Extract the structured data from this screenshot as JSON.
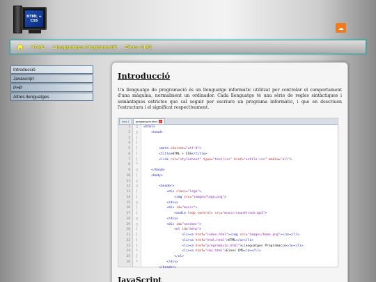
{
  "logo": {
    "text": "HTML + CSS"
  },
  "music_icon": "soundcloud-icon",
  "navbar": {
    "home_icon": "home-icon",
    "items": [
      "HTML",
      "Llenguatges Programació",
      "Eines CMS"
    ]
  },
  "sidebar": {
    "items": [
      "Introducció",
      "Javascript",
      "PHP",
      "Altres llenguatges"
    ]
  },
  "content": {
    "title": "Introducció",
    "paragraph": "Un llenguatge de programació és un llenguatge informàtic utilitzat per controlar el comportament d'una màquina, normalment un ordinador. Cada llenguatge té una sèrie de regles sintàctiques i semàntiques estrictes que cal seguir per escriure un programa informàtic, i que en descriuen l'estructura i el significat respectivament.",
    "next_title": "JavaScript"
  },
  "editor": {
    "tabs": [
      {
        "label": "new 1",
        "active": false
      },
      {
        "label": "programacio.html",
        "active": true
      }
    ],
    "line_numbers": [
      "1",
      "2",
      "3",
      "4",
      "5",
      "6",
      "7",
      "8",
      "9",
      "10",
      "11",
      "12",
      "13",
      "14",
      "15",
      "16",
      "17",
      "18",
      "19",
      "20",
      "21",
      "22",
      "23",
      "24",
      "25",
      "26"
    ],
    "folds": [
      "□",
      "□",
      "│",
      "│",
      "│",
      "│",
      "│",
      "└",
      "□",
      "│",
      "□",
      "□",
      "│",
      "│",
      "□",
      "│",
      "│",
      "□",
      "□",
      "│",
      "│",
      "│",
      "│",
      "└",
      "│",
      "└"
    ]
  },
  "colors": {
    "nav_text": "#f6f24a",
    "nav_border": "#2fa3a0",
    "music": "#f07a1e"
  }
}
